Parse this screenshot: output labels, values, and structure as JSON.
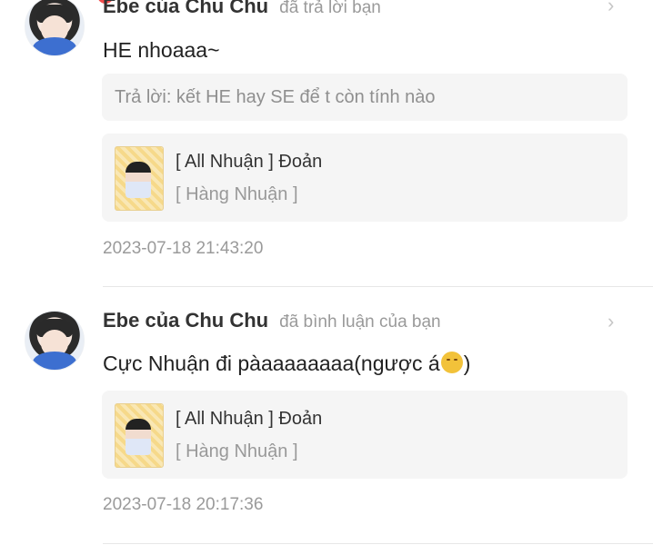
{
  "notifications": [
    {
      "username": "Ebe của Chu Chu",
      "action": "đã trả lời bạn",
      "comment": "HE nhoaaa~",
      "reply_quote": "Trả lời: kết HE hay SE để t còn tính nào",
      "story_title": "[ All Nhuận ] Đoản",
      "story_tag": "[ Hàng Nhuận ]",
      "timestamp": "2023-07-18 21:43:20"
    },
    {
      "username": "Ebe của Chu Chu",
      "action": "đã bình luận của bạn",
      "comment_before_emoji": "Cực Nhuận đi pàaaaaaaaa(ngược á",
      "comment_after_emoji": ")",
      "emoji_icon": "smirking-face-emoji",
      "story_title": "[ All Nhuận ] Đoản",
      "story_tag": "[ Hàng Nhuận ]",
      "timestamp": "2023-07-18 20:17:36"
    }
  ],
  "colors": {
    "badge": "#f24d4d",
    "card_bg": "#f5f5f5",
    "muted_text": "#9a9a9a"
  }
}
